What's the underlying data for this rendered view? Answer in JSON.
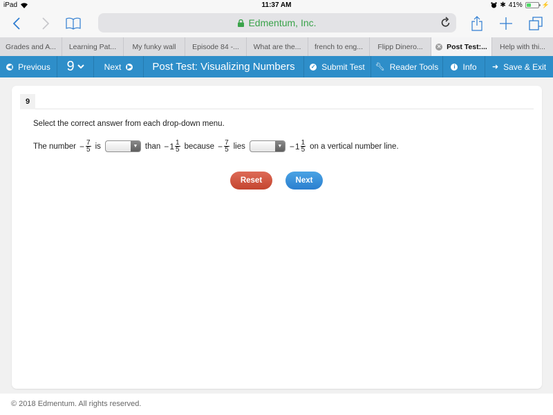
{
  "status_bar": {
    "device": "iPad",
    "time": "11:37 AM",
    "battery_percent": "41%",
    "battery_level": 0.41,
    "icons": [
      "wifi-icon",
      "alarm-icon",
      "bluetooth-icon",
      "battery-icon",
      "charging-icon"
    ]
  },
  "browser": {
    "url_text": "Edmentum, Inc.",
    "icons": {
      "back": "chevron-left-icon",
      "forward": "chevron-right-icon",
      "bookmarks": "book-icon",
      "lock": "lock-icon",
      "reload": "reload-icon",
      "share": "share-icon",
      "new_tab": "plus-icon",
      "tabs": "tabs-icon"
    },
    "colors": {
      "accent": "#2f7dd1",
      "secure": "#3aa34a"
    }
  },
  "tabs": [
    {
      "label": "Grades and A...",
      "active": false
    },
    {
      "label": "Learning Pat...",
      "active": false
    },
    {
      "label": "My funky wall",
      "active": false
    },
    {
      "label": "Episode 84 -...",
      "active": false
    },
    {
      "label": "What are the...",
      "active": false
    },
    {
      "label": "french to eng...",
      "active": false
    },
    {
      "label": "Flipp Dinero...",
      "active": false
    },
    {
      "label": "Post Test:...",
      "active": true
    },
    {
      "label": "Help with thi...",
      "active": false
    }
  ],
  "nav": {
    "previous_label": "Previous",
    "question_number": "9",
    "next_label": "Next",
    "title": "Post Test: Visualizing Numbers",
    "submit_label": "Submit Test",
    "reader_tools_label": "Reader Tools",
    "info_label": "Info",
    "save_exit_label": "Save & Exit",
    "color": "#2e8ec9"
  },
  "question": {
    "number": "9",
    "instructions": "Select the correct answer from each drop-down menu.",
    "sentence": {
      "part1": "The number",
      "frac1": {
        "sign": "−",
        "numerator": "7",
        "denominator": "5"
      },
      "part2": "is",
      "dropdown1_value": "",
      "part3": "than",
      "mixed1": {
        "sign": "−",
        "whole": "1",
        "numerator": "1",
        "denominator": "5"
      },
      "part4": "because",
      "frac2": {
        "sign": "−",
        "numerator": "7",
        "denominator": "5"
      },
      "part5": "lies",
      "dropdown2_value": "",
      "mixed2": {
        "sign": "−",
        "whole": "1",
        "numerator": "1",
        "denominator": "5"
      },
      "part6": "on a vertical number line."
    },
    "reset_label": "Reset",
    "next_label": "Next",
    "colors": {
      "reset": "#d0553f",
      "next": "#3a91da"
    }
  },
  "footer": {
    "copyright": "© 2018 Edmentum. All rights reserved."
  }
}
